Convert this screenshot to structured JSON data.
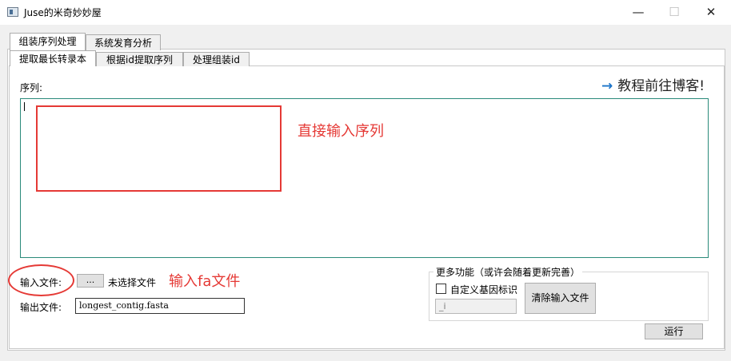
{
  "window": {
    "title": "Juse的米奇妙妙屋"
  },
  "titlebar": {
    "minimize": "—",
    "maximize": "☐",
    "close": "✕"
  },
  "outer_tabs": [
    {
      "label": "组装序列处理",
      "active": true
    },
    {
      "label": "系统发育分析",
      "active": false
    }
  ],
  "inner_tabs": [
    {
      "label": "提取最长转录本",
      "active": true
    },
    {
      "label": "根据id提取序列",
      "active": false
    },
    {
      "label": "处理组装id",
      "active": false
    }
  ],
  "sequence": {
    "label": "序列:",
    "value": ""
  },
  "blog_link": {
    "arrow": "→",
    "text": "教程前往博客!"
  },
  "annotations": {
    "sequence_hint": "直接输入序列",
    "fa_hint": "输入fa文件"
  },
  "input_file": {
    "label": "输入文件:",
    "browse": "...",
    "status": "未选择文件"
  },
  "output_file": {
    "label": "输出文件:",
    "value": "longest_contig.fasta"
  },
  "more_features": {
    "title": "更多功能（或许会随着更新完善）",
    "custom_checkbox_label": "自定义基因标识",
    "custom_checked": false,
    "gene_id_placeholder": "_i",
    "clear_button": "清除输入文件"
  },
  "run_button": "运行",
  "colors": {
    "annotation": "#e53935",
    "link_arrow": "#1a73c8",
    "textarea_border": "#2a8a7a"
  }
}
